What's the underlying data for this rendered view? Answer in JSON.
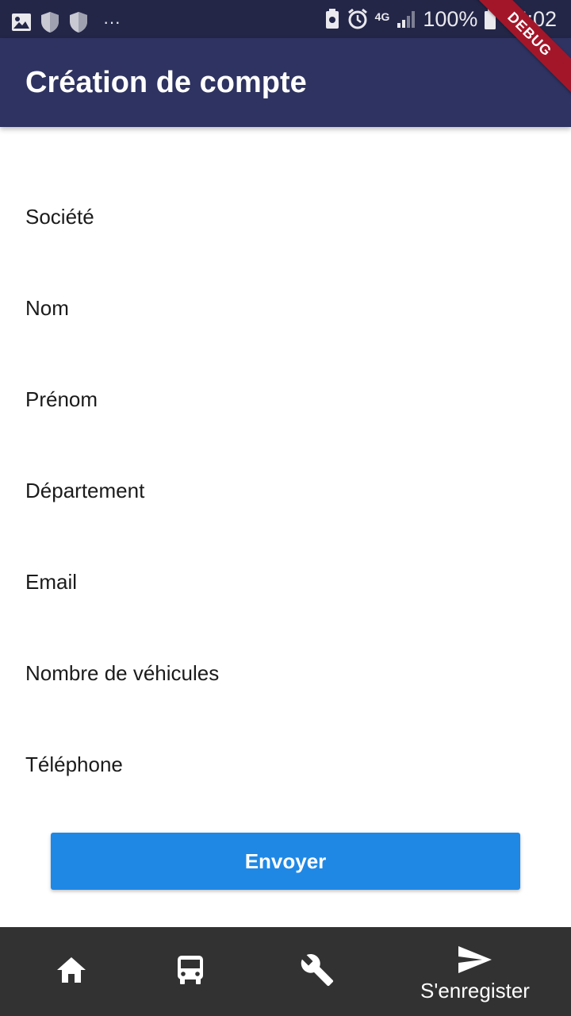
{
  "status_bar": {
    "network": "4G",
    "battery_percent": "100%",
    "time": "15:02",
    "more_dots": "···"
  },
  "app_bar": {
    "title": "Création de compte"
  },
  "debug_banner": {
    "text": "DEBUG"
  },
  "form": {
    "fields": [
      {
        "label": "Société",
        "value": ""
      },
      {
        "label": "Nom",
        "value": ""
      },
      {
        "label": "Prénom",
        "value": ""
      },
      {
        "label": "Département",
        "value": ""
      },
      {
        "label": "Email",
        "value": ""
      },
      {
        "label": "Nombre de véhicules",
        "value": ""
      },
      {
        "label": "Téléphone",
        "value": ""
      }
    ],
    "submit_label": "Envoyer"
  },
  "bottom_nav": {
    "items": [
      {
        "icon": "home-icon",
        "label": ""
      },
      {
        "icon": "bus-icon",
        "label": ""
      },
      {
        "icon": "wrench-icon",
        "label": ""
      },
      {
        "icon": "send-icon",
        "label": "S'enregister",
        "active": true
      }
    ]
  },
  "colors": {
    "status_bar": "#232647",
    "app_bar": "#2e3361",
    "accent_button": "#1f88e5",
    "bottom_nav": "#323232",
    "debug_banner": "#a3162a"
  }
}
